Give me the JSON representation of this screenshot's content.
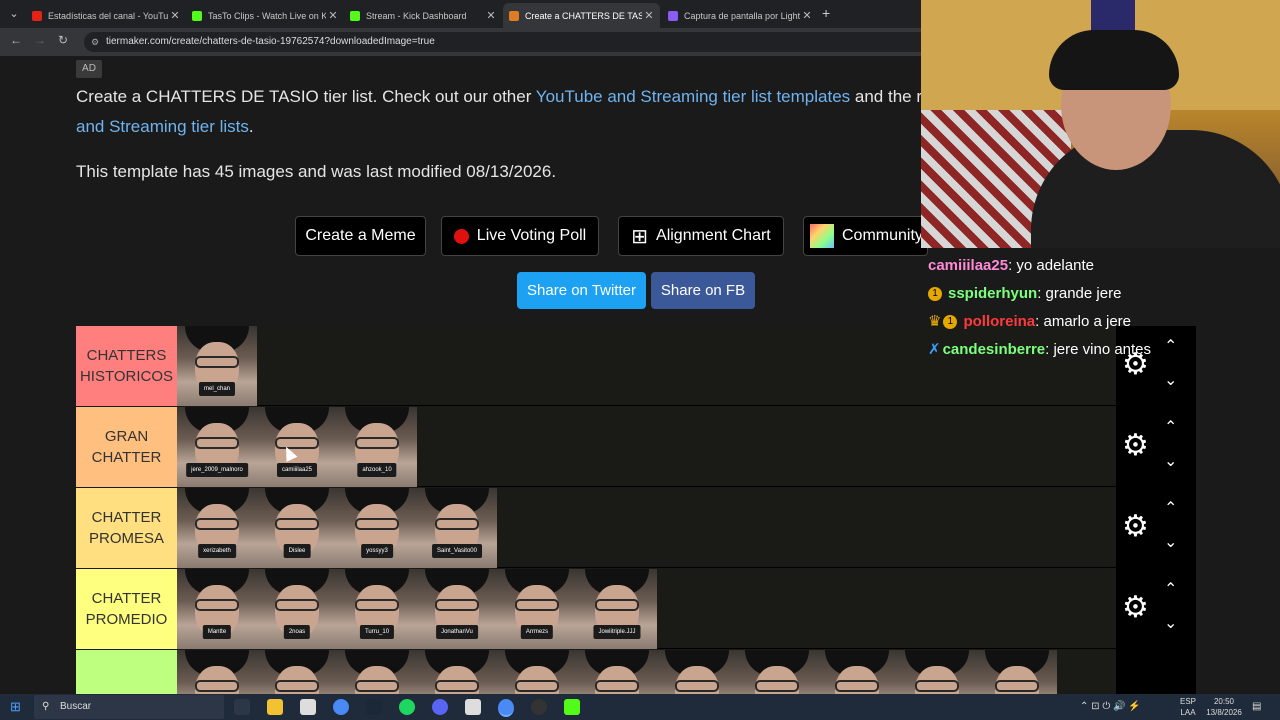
{
  "browser": {
    "tabs": [
      {
        "title": "Estadísticas del canal - YouTube",
        "fav_color": "#e62117"
      },
      {
        "title": "TasTo Clips - Watch Live on Kick",
        "fav_color": "#53fc18"
      },
      {
        "title": "Stream - Kick Dashboard",
        "fav_color": "#53fc18"
      },
      {
        "title": "Create a CHATTERS DE TASIO Tier List",
        "fav_color": "#e07b24"
      },
      {
        "title": "Captura de pantalla por Lightshot",
        "fav_color": "#8a5cf5"
      }
    ],
    "url": "tiermaker.com/create/chatters-de-tasio-19762574?downloadedImage=true"
  },
  "page": {
    "ad_label": "AD",
    "intro_prefix": "Create a CHATTERS DE TASIO tier list. Check out our other ",
    "intro_link1": "YouTube and Streaming tier list templates",
    "intro_middle": " and the r",
    "intro_link2": "and Streaming tier lists",
    "intro_suffix": ".",
    "modified_text": "This template has 45 images and was last modified 08/13/2026.",
    "buttons": {
      "meme": "Create a Meme",
      "poll": "Live Voting Poll",
      "alignment": "Alignment Chart",
      "community": "Community"
    },
    "share": {
      "twitter": "Share on Twitter",
      "fb": "Share on FB",
      "twitter_color": "#1da1f2",
      "fb_color": "#3b5998"
    }
  },
  "tiers": [
    {
      "label": "CHATTERS HISTORICOS",
      "color": "#ff7f7f",
      "items": [
        "mel_chan"
      ]
    },
    {
      "label": "GRAN CHATTER",
      "color": "#ffbf7f",
      "items": [
        "jere_2009_malnoro",
        "camiiilaa25",
        "ahzook_10"
      ]
    },
    {
      "label": "CHATTER PROMESA",
      "color": "#ffdf7f",
      "items": [
        "xerizabeth",
        "Dislee",
        "yossyy3",
        "Saint_Vasito00"
      ]
    },
    {
      "label": "CHATTER PROMEDIO",
      "color": "#ffff7f",
      "items": [
        "Mantte",
        "2noas",
        "Turru_10",
        "JonathanVu",
        "Arrmezs",
        "Jowiitriple.JJJ"
      ]
    },
    {
      "label": "",
      "color": "#bfff7f",
      "items": [
        "",
        "",
        "",
        "",
        "",
        "",
        "",
        "",
        "",
        "",
        ""
      ]
    }
  ],
  "chat": [
    {
      "user": "camiiilaa25",
      "user_color": "#ff8ad8",
      "badges": "",
      "message": ": yo adelante"
    },
    {
      "user": "sspiderhyun",
      "user_color": "#7cff7c",
      "badges": "1",
      "message": ": grande jere"
    },
    {
      "user": "polloreina",
      "user_color": "#ff3a3a",
      "badges": "crown",
      "message": ": amarlo a jere"
    },
    {
      "user": "candesinberre",
      "user_color": "#7cff7c",
      "badges": "sword",
      "message": ": jere vino antes"
    }
  ],
  "taskbar": {
    "search_placeholder": "Buscar",
    "lang": "ESP",
    "lang2": "LAA",
    "time": "20:50",
    "date": "13/8/2026"
  }
}
